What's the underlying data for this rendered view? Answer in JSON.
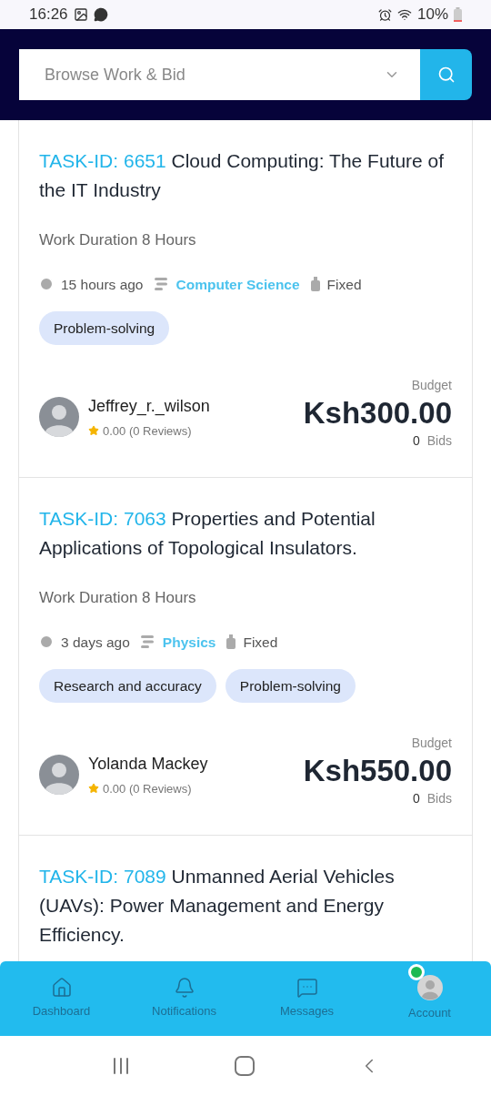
{
  "status_bar": {
    "time": "16:26",
    "battery": "10%"
  },
  "search": {
    "placeholder": "Browse Work & Bid"
  },
  "tasks": [
    {
      "id_label": "TASK-ID: 6651",
      "title": "Cloud Computing: The Future of the IT Industry",
      "duration": "Work Duration 8 Hours",
      "posted": "15 hours ago",
      "category": "Computer Science",
      "pricing": "Fixed",
      "tags": [
        "Problem-solving"
      ],
      "author": "Jeffrey_r._wilson",
      "rating": "0.00 (0 Reviews)",
      "budget_label": "Budget",
      "budget": "Ksh300.00",
      "bids_count": "0",
      "bids_label": "Bids"
    },
    {
      "id_label": "TASK-ID: 7063",
      "title": "Properties and Potential Applications of Topological Insulators.",
      "duration": "Work Duration 8 Hours",
      "posted": "3 days ago",
      "category": "Physics",
      "pricing": "Fixed",
      "tags": [
        "Research and accuracy",
        "Problem-solving"
      ],
      "author": "Yolanda Mackey",
      "rating": "0.00 (0 Reviews)",
      "budget_label": "Budget",
      "budget": "Ksh550.00",
      "bids_count": "0",
      "bids_label": "Bids"
    },
    {
      "id_label": "TASK-ID: 7089",
      "title": "Unmanned Aerial Vehicles (UAVs): Power Management and Energy Efficiency."
    }
  ],
  "bottom_nav": [
    {
      "kind": "home",
      "label": "Dashboard"
    },
    {
      "kind": "bell",
      "label": "Notifications"
    },
    {
      "kind": "chat",
      "label": "Messages"
    },
    {
      "kind": "account",
      "label": "Account",
      "online": true
    }
  ]
}
